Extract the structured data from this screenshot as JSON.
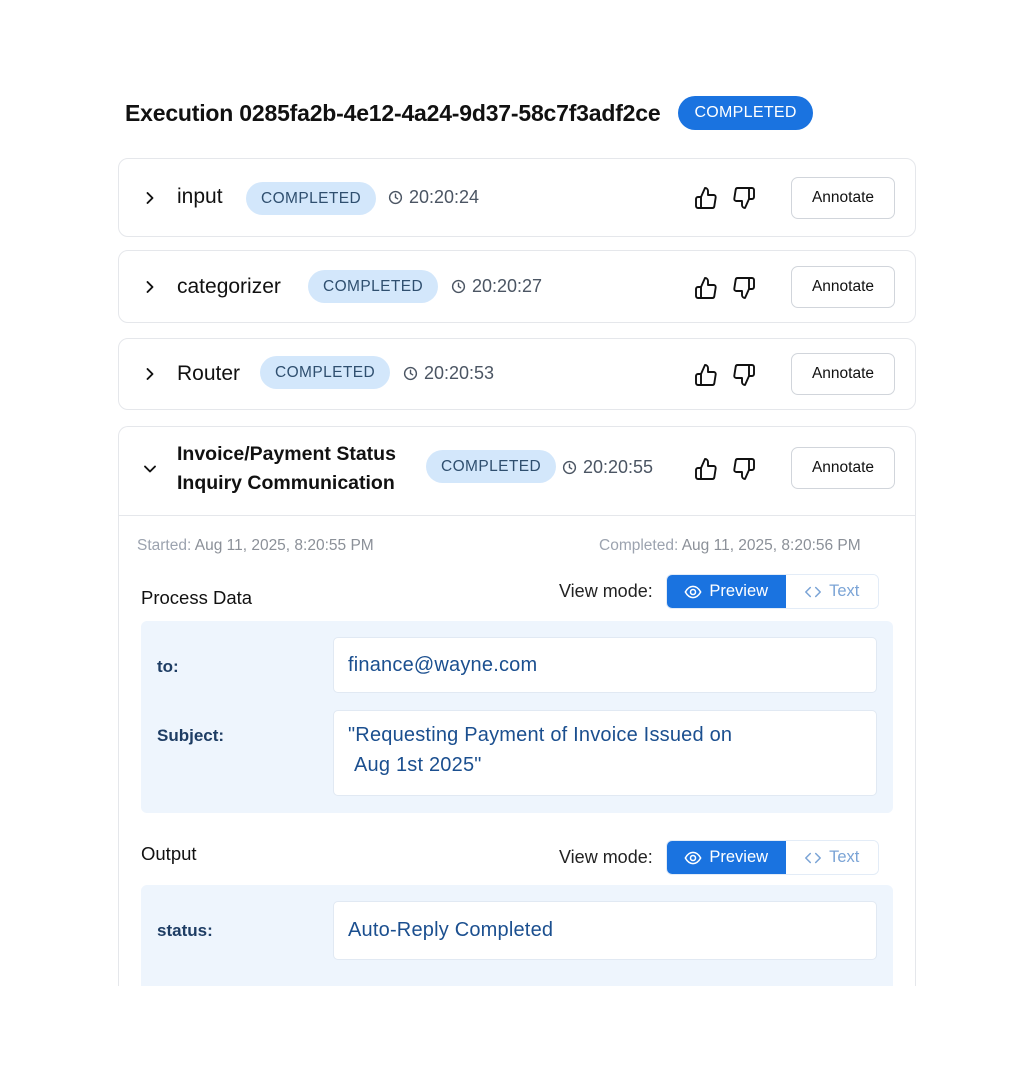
{
  "execution": {
    "title": "Execution 0285fa2b-4e12-4a24-9d37-58c7f3adf2ce",
    "status": "COMPLETED"
  },
  "colors": {
    "accent": "#1a73e0",
    "badge_bg": "#d3e7fb",
    "panel_bg": "#eef5fd",
    "value_text": "#1b4f8f"
  },
  "nodes": [
    {
      "name": "input",
      "status": "COMPLETED",
      "time": "20:20:24",
      "annotate_label": "Annotate",
      "expanded": false
    },
    {
      "name": "categorizer",
      "status": "COMPLETED",
      "time": "20:20:27",
      "annotate_label": "Annotate",
      "expanded": false
    },
    {
      "name": "Router",
      "status": "COMPLETED",
      "time": "20:20:53",
      "annotate_label": "Annotate",
      "expanded": false
    },
    {
      "name_line1": "Invoice/Payment Status",
      "name_line2": "Inquiry Communication",
      "status": "COMPLETED",
      "time": "20:20:55",
      "annotate_label": "Annotate",
      "expanded": true,
      "started_label": "Started:",
      "started_value": "Aug 11, 2025, 8:20:55 PM",
      "completed_label": "Completed:",
      "completed_value": "Aug 11, 2025, 8:20:56 PM",
      "process_data": {
        "title": "Process Data",
        "view_mode_label": "View mode:",
        "preview_label": "Preview",
        "text_label": "Text",
        "fields": [
          {
            "label": "to:",
            "value": "finance@wayne.com"
          },
          {
            "label": "Subject:",
            "value_line1": "\"Requesting Payment of Invoice Issued on",
            "value_line2": "Aug 1st 2025\""
          }
        ]
      },
      "output": {
        "title": "Output",
        "view_mode_label": "View mode:",
        "preview_label": "Preview",
        "text_label": "Text",
        "fields": [
          {
            "label": "status:",
            "value": "Auto-Reply Completed"
          }
        ]
      }
    }
  ],
  "icons": {
    "expand": "chevron-right-icon",
    "collapse": "chevron-down-icon",
    "time": "clock-icon",
    "like": "thumbs-up-icon",
    "dislike": "thumbs-down-icon",
    "preview": "eye-icon",
    "text": "code-icon"
  }
}
